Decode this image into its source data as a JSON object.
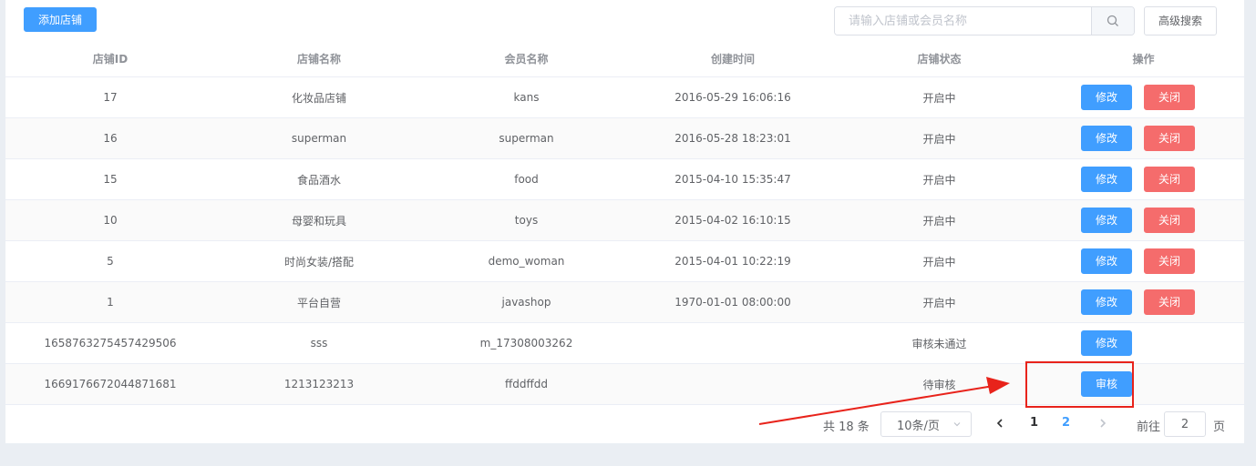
{
  "toolbar": {
    "add_label": "添加店铺",
    "search_placeholder": "请输入店铺或会员名称",
    "advanced_label": "高级搜索"
  },
  "table": {
    "headers": [
      "店铺ID",
      "店铺名称",
      "会员名称",
      "创建时间",
      "店铺状态",
      "操作"
    ],
    "rows": [
      {
        "id": "17",
        "shop": "化妆品店铺",
        "member": "kans",
        "created": "2016-05-29 16:06:16",
        "status": "开启中",
        "actions": [
          "修改",
          "关闭"
        ]
      },
      {
        "id": "16",
        "shop": "superman",
        "member": "superman",
        "created": "2016-05-28 18:23:01",
        "status": "开启中",
        "actions": [
          "修改",
          "关闭"
        ]
      },
      {
        "id": "15",
        "shop": "食品酒水",
        "member": "food",
        "created": "2015-04-10 15:35:47",
        "status": "开启中",
        "actions": [
          "修改",
          "关闭"
        ]
      },
      {
        "id": "10",
        "shop": "母婴和玩具",
        "member": "toys",
        "created": "2015-04-02 16:10:15",
        "status": "开启中",
        "actions": [
          "修改",
          "关闭"
        ]
      },
      {
        "id": "5",
        "shop": "时尚女装/搭配",
        "member": "demo_woman",
        "created": "2015-04-01 10:22:19",
        "status": "开启中",
        "actions": [
          "修改",
          "关闭"
        ]
      },
      {
        "id": "1",
        "shop": "平台自营",
        "member": "javashop",
        "created": "1970-01-01 08:00:00",
        "status": "开启中",
        "actions": [
          "修改",
          "关闭"
        ]
      },
      {
        "id": "1658763275457429506",
        "shop": "sss",
        "member": "m_17308003262",
        "created": "",
        "status": "审核未通过",
        "actions": [
          "修改"
        ]
      },
      {
        "id": "1669176672044871681",
        "shop": "1213123213",
        "member": "ffddffdd",
        "created": "",
        "status": "待审核",
        "actions": [
          "审核"
        ]
      }
    ]
  },
  "pager": {
    "total": "共 18 条",
    "page_size": "10条/页",
    "pages": [
      "1",
      "2"
    ],
    "goto_label": "前往",
    "goto_value": "2",
    "page_unit": "页"
  },
  "colors": {
    "primary": "#409eff",
    "danger": "#f56c6c",
    "annotation": "#e8231b"
  }
}
